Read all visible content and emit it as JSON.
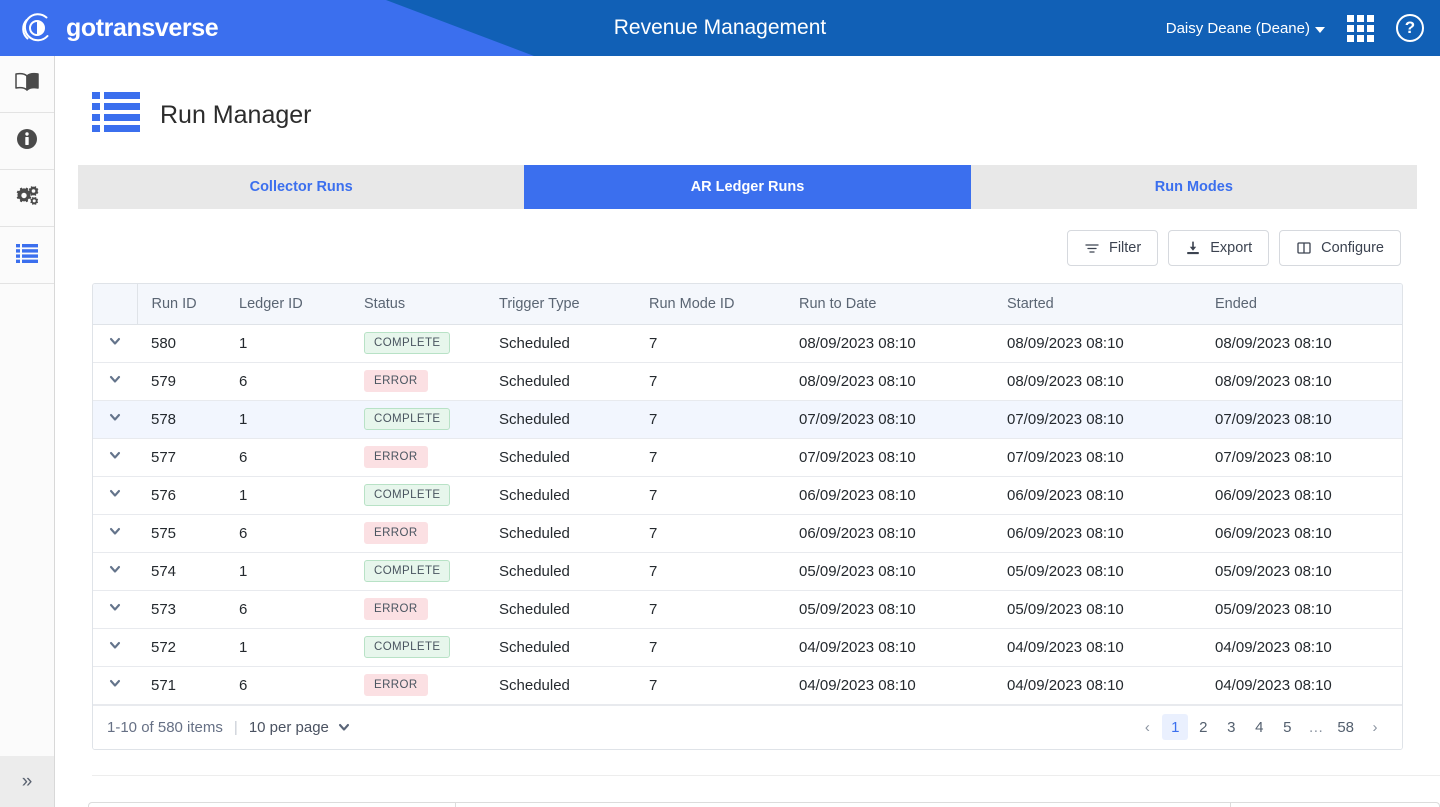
{
  "header": {
    "brand": "gotransverse",
    "brand_logo_icon": "gotransverse-circle-logo",
    "title": "Revenue Management",
    "user": "Daisy Deane (Deane)",
    "user_caret_icon": "caret-down-icon",
    "apps_icon": "apps-grid-icon",
    "help_icon": "help-circle-icon",
    "colors": {
      "accent_light": "#3b6fee",
      "accent_dark": "#1160b6"
    }
  },
  "rail": {
    "items": [
      {
        "icon": "book-icon",
        "name": "docs"
      },
      {
        "icon": "info-circle-icon",
        "name": "info"
      },
      {
        "icon": "gears-icon",
        "name": "settings"
      },
      {
        "icon": "list-icon",
        "name": "run-manager",
        "active": true
      }
    ],
    "expand_icon": "double-chevron-right-icon"
  },
  "page": {
    "title": "Run Manager",
    "title_icon": "list-blocks-icon"
  },
  "tabs": [
    {
      "label": "Collector Runs",
      "active": false
    },
    {
      "label": "AR Ledger Runs",
      "active": true
    },
    {
      "label": "Run Modes",
      "active": false
    }
  ],
  "toolbar": {
    "filter_label": "Filter",
    "filter_icon": "filter-lines-icon",
    "export_label": "Export",
    "export_icon": "download-icon",
    "configure_label": "Configure",
    "configure_icon": "columns-icon"
  },
  "table": {
    "columns": [
      "Run ID",
      "Ledger ID",
      "Status",
      "Trigger Type",
      "Run Mode ID",
      "Run to Date",
      "Started",
      "Ended"
    ],
    "row_expand_icon": "chevron-down-icon",
    "rows": [
      {
        "run_id": "580",
        "ledger_id": "1",
        "status": "COMPLETE",
        "status_kind": "complete",
        "trigger_type": "Scheduled",
        "run_mode_id": "7",
        "run_to_date": "08/09/2023 08:10",
        "started": "08/09/2023 08:10",
        "ended": "08/09/2023 08:10",
        "highlight": false
      },
      {
        "run_id": "579",
        "ledger_id": "6",
        "status": "ERROR",
        "status_kind": "error",
        "trigger_type": "Scheduled",
        "run_mode_id": "7",
        "run_to_date": "08/09/2023 08:10",
        "started": "08/09/2023 08:10",
        "ended": "08/09/2023 08:10",
        "highlight": false
      },
      {
        "run_id": "578",
        "ledger_id": "1",
        "status": "COMPLETE",
        "status_kind": "complete",
        "trigger_type": "Scheduled",
        "run_mode_id": "7",
        "run_to_date": "07/09/2023 08:10",
        "started": "07/09/2023 08:10",
        "ended": "07/09/2023 08:10",
        "highlight": true
      },
      {
        "run_id": "577",
        "ledger_id": "6",
        "status": "ERROR",
        "status_kind": "error",
        "trigger_type": "Scheduled",
        "run_mode_id": "7",
        "run_to_date": "07/09/2023 08:10",
        "started": "07/09/2023 08:10",
        "ended": "07/09/2023 08:10",
        "highlight": false
      },
      {
        "run_id": "576",
        "ledger_id": "1",
        "status": "COMPLETE",
        "status_kind": "complete",
        "trigger_type": "Scheduled",
        "run_mode_id": "7",
        "run_to_date": "06/09/2023 08:10",
        "started": "06/09/2023 08:10",
        "ended": "06/09/2023 08:10",
        "highlight": false
      },
      {
        "run_id": "575",
        "ledger_id": "6",
        "status": "ERROR",
        "status_kind": "error",
        "trigger_type": "Scheduled",
        "run_mode_id": "7",
        "run_to_date": "06/09/2023 08:10",
        "started": "06/09/2023 08:10",
        "ended": "06/09/2023 08:10",
        "highlight": false
      },
      {
        "run_id": "574",
        "ledger_id": "1",
        "status": "COMPLETE",
        "status_kind": "complete",
        "trigger_type": "Scheduled",
        "run_mode_id": "7",
        "run_to_date": "05/09/2023 08:10",
        "started": "05/09/2023 08:10",
        "ended": "05/09/2023 08:10",
        "highlight": false
      },
      {
        "run_id": "573",
        "ledger_id": "6",
        "status": "ERROR",
        "status_kind": "error",
        "trigger_type": "Scheduled",
        "run_mode_id": "7",
        "run_to_date": "05/09/2023 08:10",
        "started": "05/09/2023 08:10",
        "ended": "05/09/2023 08:10",
        "highlight": false
      },
      {
        "run_id": "572",
        "ledger_id": "1",
        "status": "COMPLETE",
        "status_kind": "complete",
        "trigger_type": "Scheduled",
        "run_mode_id": "7",
        "run_to_date": "04/09/2023 08:10",
        "started": "04/09/2023 08:10",
        "ended": "04/09/2023 08:10",
        "highlight": false
      },
      {
        "run_id": "571",
        "ledger_id": "6",
        "status": "ERROR",
        "status_kind": "error",
        "trigger_type": "Scheduled",
        "run_mode_id": "7",
        "run_to_date": "04/09/2023 08:10",
        "started": "04/09/2023 08:10",
        "ended": "04/09/2023 08:10",
        "highlight": false
      }
    ]
  },
  "pagination": {
    "summary": "1-10 of 580 items",
    "separator": "|",
    "per_page": "10 per page",
    "per_page_icon": "chevron-down-icon",
    "prev_icon": "‹",
    "next_icon": "›",
    "pages": [
      "1",
      "2",
      "3",
      "4",
      "5",
      "…",
      "58"
    ],
    "active_page": "1"
  }
}
